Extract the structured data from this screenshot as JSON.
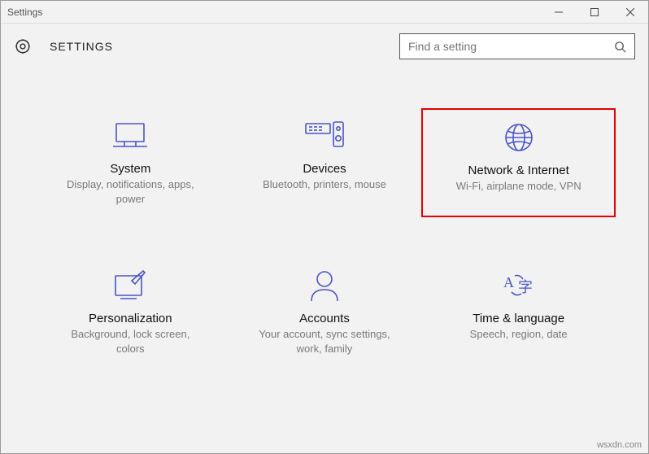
{
  "window": {
    "title": "Settings"
  },
  "header": {
    "label": "SETTINGS"
  },
  "search": {
    "placeholder": "Find a setting"
  },
  "tiles": [
    {
      "title": "System",
      "sub": "Display, notifications, apps, power"
    },
    {
      "title": "Devices",
      "sub": "Bluetooth, printers, mouse"
    },
    {
      "title": "Network & Internet",
      "sub": "Wi-Fi, airplane mode, VPN"
    },
    {
      "title": "Personalization",
      "sub": "Background, lock screen, colors"
    },
    {
      "title": "Accounts",
      "sub": "Your account, sync settings, work, family"
    },
    {
      "title": "Time & language",
      "sub": "Speech, region, date"
    }
  ],
  "watermark": "wsxdn.com"
}
